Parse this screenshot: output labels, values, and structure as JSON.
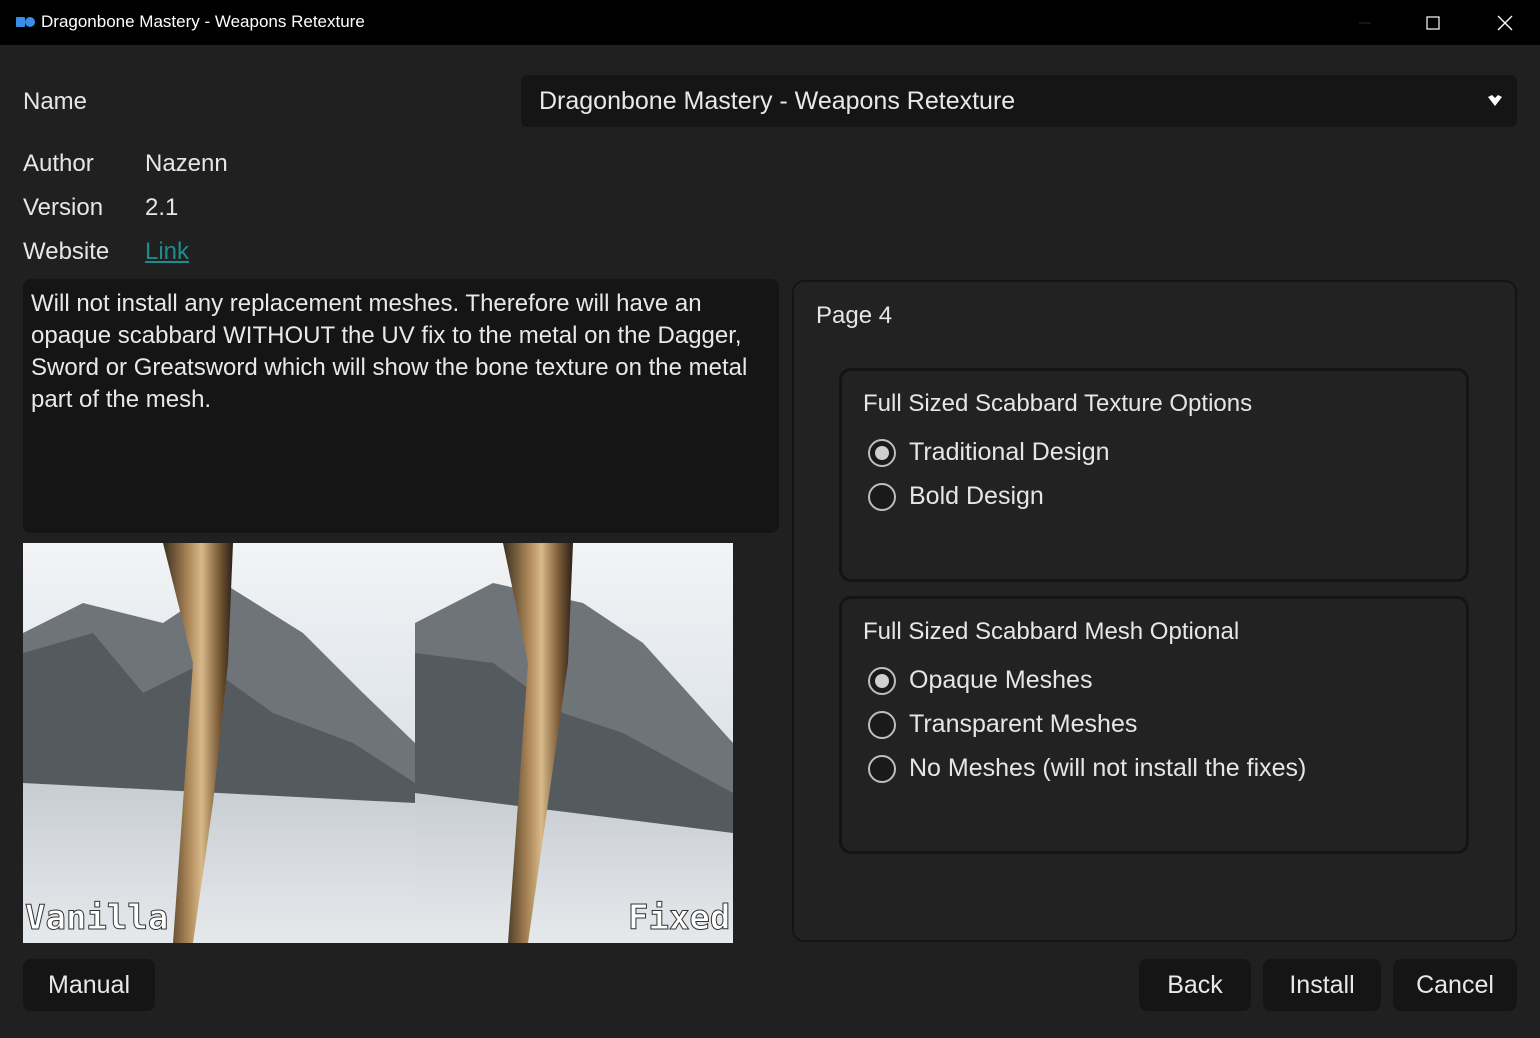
{
  "window": {
    "title": "Dragonbone Mastery - Weapons Retexture"
  },
  "fields": {
    "name_label": "Name",
    "author_label": "Author",
    "author_value": "Nazenn",
    "version_label": "Version",
    "version_value": "2.1",
    "website_label": "Website",
    "website_link": "Link"
  },
  "name_dropdown": {
    "selected": "Dragonbone Mastery - Weapons Retexture"
  },
  "description": "Will not install any replacement meshes. Therefore will have an opaque scabbard WITHOUT the UV fix to the metal on the Dagger, Sword or Greatsword which will show the bone texture on the metal part of the mesh.",
  "preview": {
    "left_caption": "Vanilla",
    "right_caption": "Fixed"
  },
  "page": {
    "title": "Page 4",
    "groups": [
      {
        "title": "Full Sized Scabbard Texture Options",
        "options": [
          {
            "label": "Traditional Design",
            "checked": true
          },
          {
            "label": "Bold Design",
            "checked": false
          }
        ]
      },
      {
        "title": "Full Sized Scabbard Mesh Optional",
        "options": [
          {
            "label": "Opaque Meshes",
            "checked": true
          },
          {
            "label": "Transparent Meshes",
            "checked": false
          },
          {
            "label": "No Meshes (will not install the fixes)",
            "checked": false
          }
        ]
      }
    ]
  },
  "buttons": {
    "manual": "Manual",
    "back": "Back",
    "install": "Install",
    "cancel": "Cancel"
  },
  "colors": {
    "background": "#202020",
    "titlebar": "#000000",
    "field_bg": "#151515",
    "link": "#1e8c8c",
    "app_icon": "#3a8ee6"
  },
  "icons": {
    "app": "app-logo-icon",
    "minimize": "minimize-icon",
    "maximize": "maximize-icon",
    "close": "close-icon",
    "dropdown": "chevron-down-icon"
  }
}
